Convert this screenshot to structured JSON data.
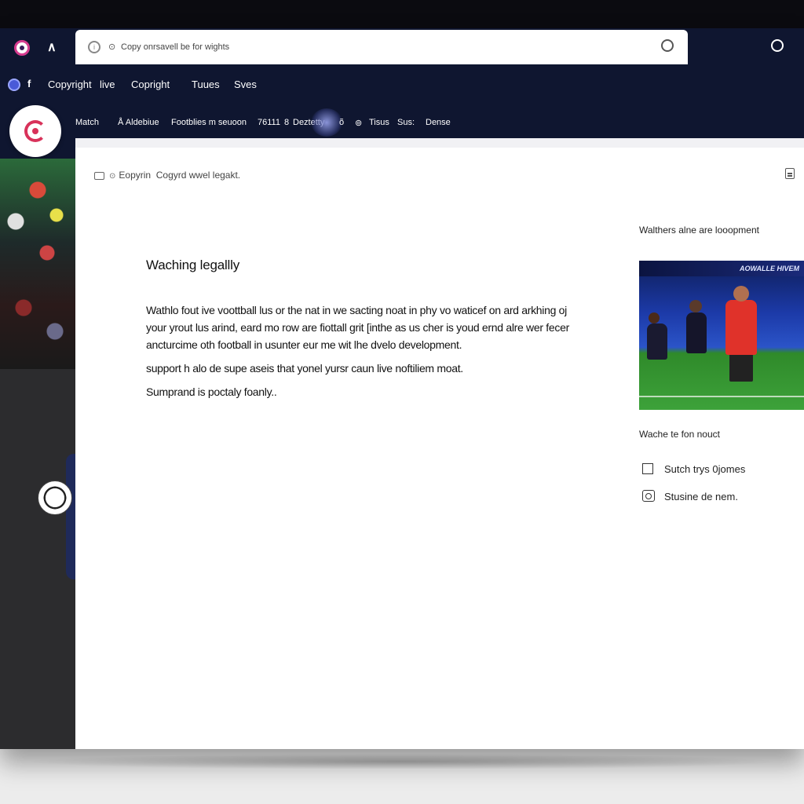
{
  "browser": {
    "address_text": "Copy onrsavell be for wights"
  },
  "tabs": [
    {
      "label": "Copyright"
    },
    {
      "label": "live"
    },
    {
      "label": "Copright"
    },
    {
      "label": "Tuues"
    },
    {
      "label": "Sves"
    }
  ],
  "nav": {
    "items": [
      {
        "label": "Match"
      },
      {
        "label": "Å Aldebiue"
      },
      {
        "label": "Footblies m seuoon"
      },
      {
        "label": "76111"
      },
      {
        "label": "8"
      },
      {
        "label": "Deztetty"
      },
      {
        "label": "õ"
      },
      {
        "label": "Tisus"
      },
      {
        "label": "Sus:"
      },
      {
        "label": "Dense"
      }
    ]
  },
  "content": {
    "breadcrumb": {
      "label1": "Eopyrin",
      "label2": "Cogyrd wwel legakt."
    },
    "article": {
      "title": "Waching legallly",
      "paragraphs": [
        "Wathlo fout ive voottball lus or the nat in we sacting noat in phy vo waticef on ard arkhing oj your yrout lus arind, eard mo row are fiottall grit [inthe as us cher is youd ernd alre wer fecer ancturcime oth football in usunter eur me wit lhe dvelo development.",
        "support h alo de supe aseis that yonel yursr caun live noftiliem moat.",
        "Sumprand is poctaly foanly.."
      ]
    },
    "sidebar": {
      "heading": "Walthers alne are looopment",
      "image_banner": "AOWALLE HIVEM",
      "subheading": "Wache te fon nouct",
      "links": [
        {
          "label": "Sutch trys 0jomes",
          "icon": "checkbox-icon"
        },
        {
          "label": "Stusine de nem.",
          "icon": "camera-icon"
        }
      ]
    }
  },
  "colors": {
    "frame": "#0f1630",
    "brand": "#d8325a",
    "content_bg": "#ffffff"
  }
}
